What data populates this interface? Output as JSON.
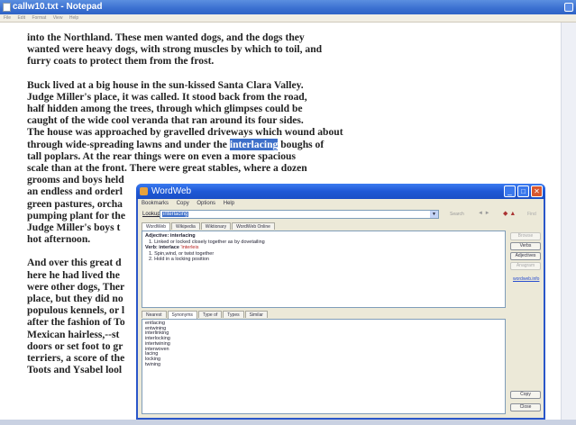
{
  "notepad": {
    "title": "callw10.txt - Notepad",
    "menu": [
      "File",
      "Edit",
      "Format",
      "View",
      "Help"
    ],
    "paragraphs": [
      [
        "into the Northland.  These men wanted dogs, and the dogs they",
        "wanted were heavy dogs, with strong muscles by which to toil, and",
        "furry coats to protect them from the frost."
      ],
      [
        "Buck lived at a big house in the sun-kissed Santa Clara Valley.",
        "Judge Miller's place, it was called.  It stood back from the road,",
        "half hidden among the trees, through which glimpses could be",
        "caught of the wide cool veranda that ran around its four sides.",
        "The house was approached by gravelled driveways which wound about"
      ],
      [
        "tall poplars.  At the rear things were on even a more spacious",
        "scale than at the front.  There were great stables, where a dozen",
        "grooms and boys held",
        "an endless and orderl",
        "green pastures, orcha",
        "pumping plant for the",
        "Judge Miller's boys t",
        "hot afternoon."
      ],
      [
        "And over this great d",
        "here he had lived the",
        "were other dogs, Ther",
        "place, but they did no",
        "populous kennels, or l",
        "after the fashion of To",
        "Mexican hairless,--st",
        "doors or set foot to gr",
        "terriers, a score of the",
        "Toots and Ysabel lool"
      ]
    ],
    "highlight_line": {
      "before": "through wide-spreading lawns and under the ",
      "highlighted": "interlacing",
      "after": " boughs of"
    }
  },
  "wordweb": {
    "title": "WordWeb",
    "menu": [
      "Bookmarks",
      "Copy",
      "Options",
      "Help"
    ],
    "lookup_label": "Lookup:",
    "lookup_value": "interlacing",
    "search_label": "Search",
    "nav_text": "◄ ►",
    "find_label": "Find",
    "top_tabs": [
      "WordWeb",
      "Wikipedia",
      "Wiktionary",
      "WordWeb Online"
    ],
    "definitions": [
      {
        "pos": "Adjective:",
        "lemma": "interlacing",
        "lemma_colored": false,
        "senses": [
          "1.  Linked or locked closely together as by dovetailing"
        ]
      },
      {
        "pos": "Verb:",
        "lemma": "interlace",
        "lemma_extra": "'interleis",
        "senses": [
          "1.  Spin,wind, or twist together",
          "2.  Hold in a locking position"
        ]
      }
    ],
    "bottom_tabs": [
      "Nearest",
      "Synonyms",
      "Type of",
      "Types",
      "Similar"
    ],
    "synonyms": [
      "entlacing",
      "entwining",
      "interlinking",
      "interlocking",
      "intertwining",
      "interwoven",
      "lacing",
      "locking",
      "twining"
    ],
    "side_buttons": [
      "Browse",
      "Verbs",
      "Adjectives",
      "Anagram"
    ],
    "side_link": "wordweb.info",
    "copy_button": "Copy",
    "close_button": "Close"
  }
}
